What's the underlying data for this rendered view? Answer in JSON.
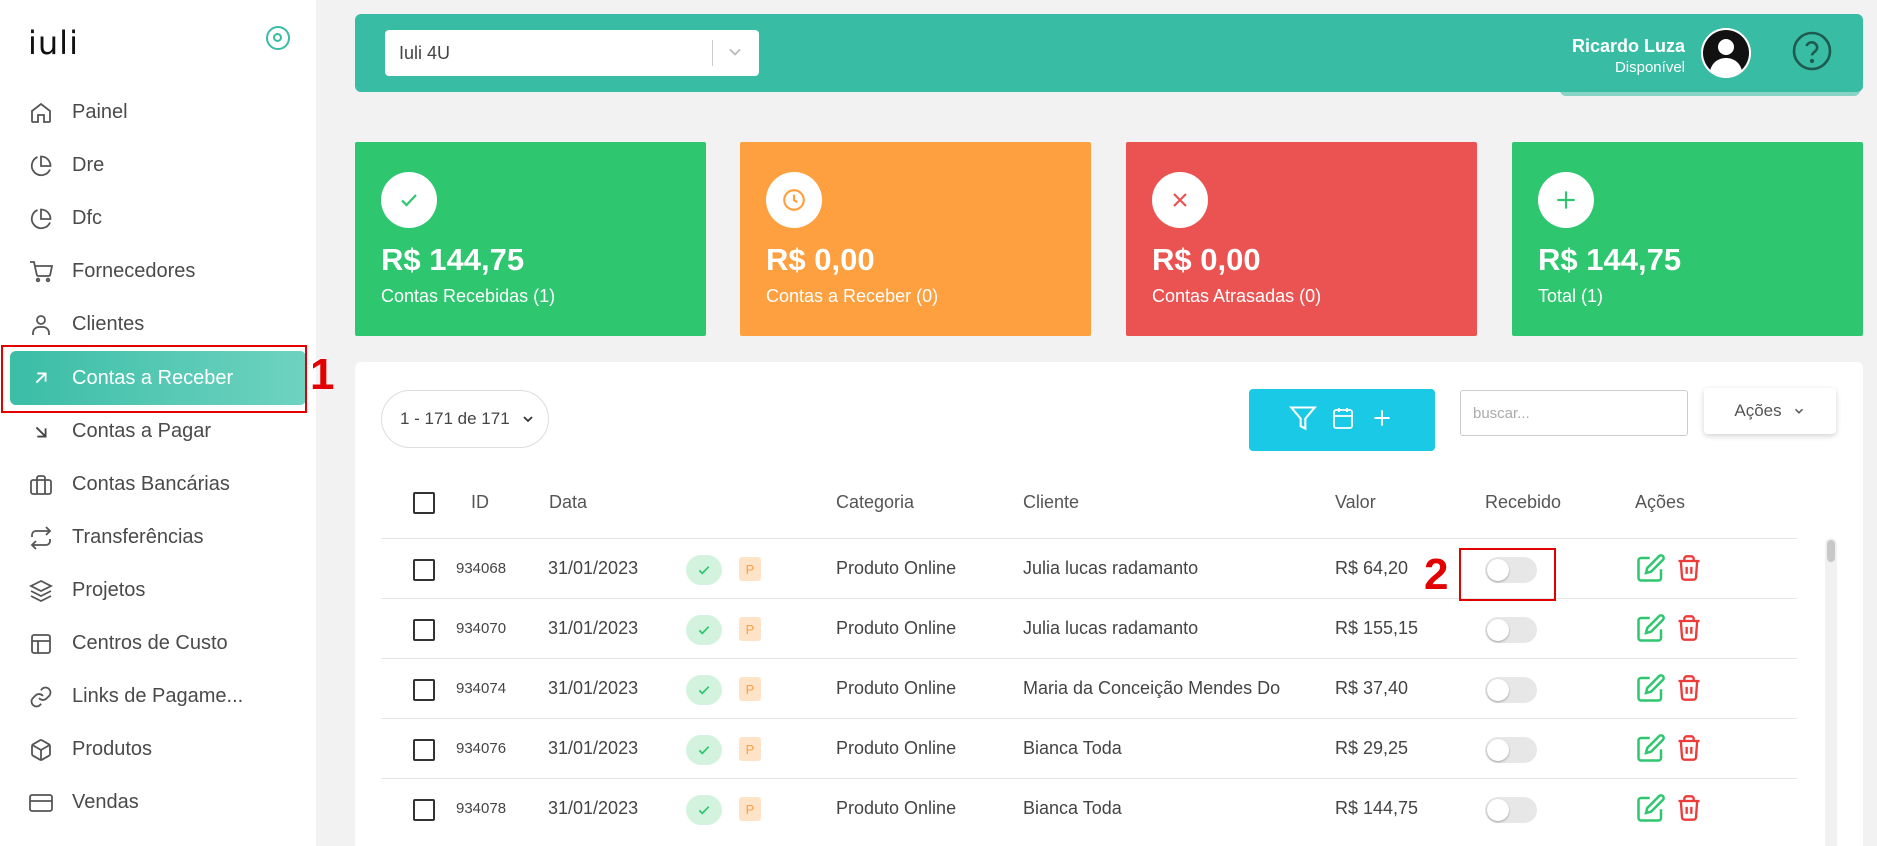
{
  "brand": {
    "logo_text": "iuli"
  },
  "sidebar": {
    "items": [
      {
        "label": "Painel",
        "icon": "home-icon"
      },
      {
        "label": "Dre",
        "icon": "pie-chart-icon"
      },
      {
        "label": "Dfc",
        "icon": "pie-chart-icon"
      },
      {
        "label": "Fornecedores",
        "icon": "cart-icon"
      },
      {
        "label": "Clientes",
        "icon": "user-icon"
      },
      {
        "label": "Contas a Receber",
        "icon": "arrow-up-right-icon",
        "active": true
      },
      {
        "label": "Contas a Pagar",
        "icon": "arrow-down-right-icon"
      },
      {
        "label": "Contas Bancárias",
        "icon": "briefcase-icon"
      },
      {
        "label": "Transferências",
        "icon": "repeat-icon"
      },
      {
        "label": "Projetos",
        "icon": "layers-icon"
      },
      {
        "label": "Centros de Custo",
        "icon": "layout-icon"
      },
      {
        "label": "Links de Pagame...",
        "icon": "link-icon"
      },
      {
        "label": "Produtos",
        "icon": "box-icon"
      },
      {
        "label": "Vendas",
        "icon": "credit-card-icon"
      }
    ]
  },
  "annotations": {
    "marker_1": "1",
    "marker_2": "2",
    "color": "#e30000"
  },
  "header": {
    "company_select": "Iuli 4U",
    "user_name": "Ricardo Luza",
    "user_status": "Disponível",
    "bg_color": "#38bca4"
  },
  "cards": [
    {
      "amount": "R$ 144,75",
      "label": "Contas Recebidas (1)",
      "color": "#2ec66f",
      "icon": "check-icon"
    },
    {
      "amount": "R$ 0,00",
      "label": "Contas a Receber (0)",
      "color": "#ffa040",
      "icon": "clock-icon"
    },
    {
      "amount": "R$ 0,00",
      "label": "Contas Atrasadas (0)",
      "color": "#eb5353",
      "icon": "x-icon"
    },
    {
      "amount": "R$ 144,75",
      "label": "Total (1)",
      "color": "#2ec66f",
      "icon": "plus-icon"
    }
  ],
  "toolbar": {
    "pager": "1 - 171 de 171",
    "search_placeholder": "buscar...",
    "actions_label": "Ações"
  },
  "table": {
    "headers": {
      "id": "ID",
      "date": "Data",
      "category": "Categoria",
      "client": "Cliente",
      "value": "Valor",
      "received": "Recebido",
      "actions": "Ações"
    },
    "rows": [
      {
        "id": "934068",
        "date": "31/01/2023",
        "badge": "P",
        "category": "Produto Online",
        "client": "Julia lucas radamanto",
        "value": "R$ 64,20",
        "received": false
      },
      {
        "id": "934070",
        "date": "31/01/2023",
        "badge": "P",
        "category": "Produto Online",
        "client": "Julia lucas radamanto",
        "value": "R$ 155,15",
        "received": false
      },
      {
        "id": "934074",
        "date": "31/01/2023",
        "badge": "P",
        "category": "Produto Online",
        "client": "Maria da Conceição Mendes Do",
        "value": "R$ 37,40",
        "received": false
      },
      {
        "id": "934076",
        "date": "31/01/2023",
        "badge": "P",
        "category": "Produto Online",
        "client": "Bianca Toda",
        "value": "R$ 29,25",
        "received": false
      },
      {
        "id": "934078",
        "date": "31/01/2023",
        "badge": "P",
        "category": "Produto Online",
        "client": "Bianca Toda",
        "value": "R$ 144,75",
        "received": false
      }
    ]
  }
}
